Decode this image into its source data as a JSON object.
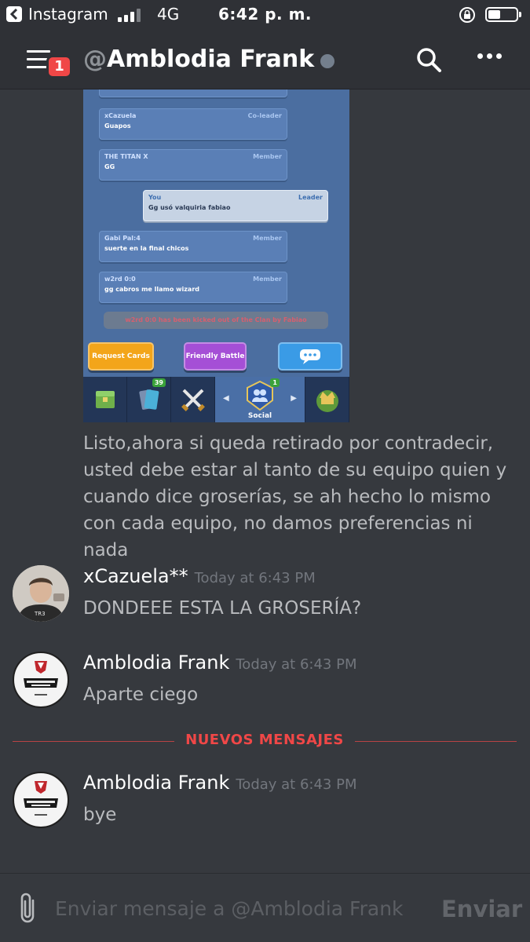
{
  "status_bar": {
    "back_app": "Instagram",
    "network": "4G",
    "time": "6:42 p. m.",
    "battery_level": 0.45
  },
  "header": {
    "menu_badge": "1",
    "at_symbol": "@",
    "dm_name": "Amblodia Frank",
    "presence": "offline"
  },
  "game_screenshot": {
    "chat": [
      {
        "name": "xCazuela",
        "role": "Co-leader",
        "text": "Guapos"
      },
      {
        "name": "THE TITAN X",
        "role": "Member",
        "text": "GG"
      },
      {
        "name": "You",
        "role": "Leader",
        "text": "Gg usó valquiria fabiao"
      },
      {
        "name": "Gabi Pal:4",
        "role": "Member",
        "text": "suerte en la final chicos"
      },
      {
        "name": "w2rd 0:0",
        "role": "Member",
        "text": "gg cabros me llamo wizard"
      }
    ],
    "kicked_notice": "w2rd 0:0 has been kicked out of the Clan by Fabiao",
    "buttons": {
      "request": "Request Cards",
      "friendly": "Friendly Battle"
    },
    "tabs": {
      "cards_badge": "39",
      "social_badge": "1",
      "social_label": "Social"
    }
  },
  "caption": "Listo,ahora si queda retirado por contradecir, usted debe estar al tanto de su equipo quien y cuando dice groserías, se ah hecho lo mismo con cada equipo, no damos preferencias ni nada",
  "messages": [
    {
      "author": "xCazuela**",
      "timestamp": "Today at 6:43 PM",
      "text": "DONDEEE ESTA LA GROSERÍA?"
    },
    {
      "author": "Amblodia Frank",
      "timestamp": "Today at 6:43 PM",
      "text": "Aparte ciego"
    },
    {
      "author": "Amblodia Frank",
      "timestamp": "Today at 6:43 PM",
      "text": "bye"
    }
  ],
  "divider_label": "NUEVOS MENSAJES",
  "composer": {
    "placeholder": "Enviar mensaje a @Amblodia Frank",
    "value": "",
    "send_label": "Enviar"
  },
  "colors": {
    "background": "#36393e",
    "header": "#2f3136",
    "new_messages_red": "#f04747",
    "badge_red": "#f04747",
    "muted_text": "#b9bbbe"
  },
  "icons": [
    "back-icon",
    "signal-icon",
    "orientation-lock-icon",
    "battery-icon",
    "hamburger-menu-icon",
    "search-icon",
    "more-dots-icon",
    "paperclip-icon"
  ]
}
